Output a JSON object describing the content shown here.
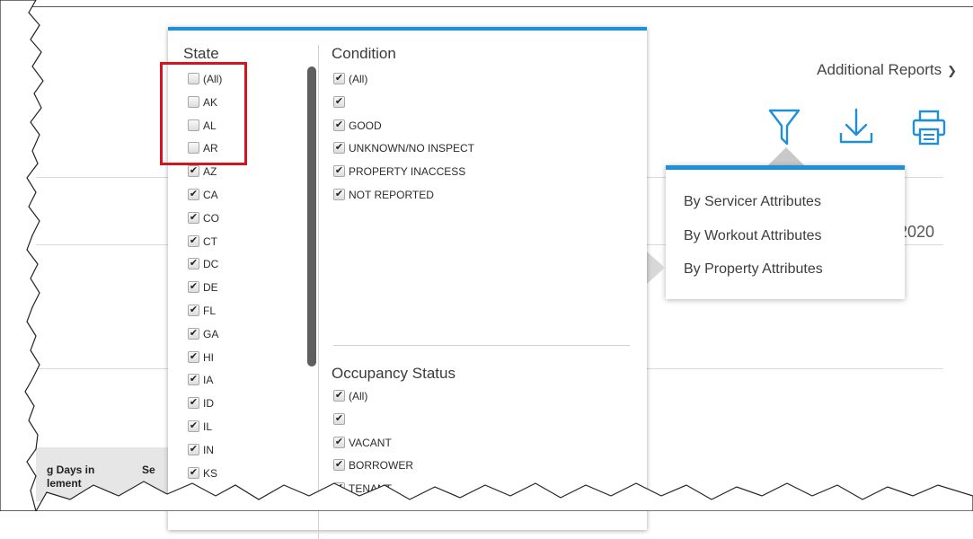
{
  "header": {
    "additional_reports_label": "Additional Reports"
  },
  "toolbar": {
    "icons": [
      "filter-icon",
      "download-icon",
      "print-icon"
    ],
    "accent_color": "#1e8fd9"
  },
  "background": {
    "year_partial": "2020",
    "grid_headers": [
      "g Days in lement",
      "Se"
    ]
  },
  "filter_panel": {
    "state": {
      "title": "State",
      "items": [
        {
          "label": "(All)",
          "checked": false
        },
        {
          "label": "AK",
          "checked": false
        },
        {
          "label": "AL",
          "checked": false
        },
        {
          "label": "AR",
          "checked": false
        },
        {
          "label": "AZ",
          "checked": true
        },
        {
          "label": "CA",
          "checked": true
        },
        {
          "label": "CO",
          "checked": true
        },
        {
          "label": "CT",
          "checked": true
        },
        {
          "label": "DC",
          "checked": true
        },
        {
          "label": "DE",
          "checked": true
        },
        {
          "label": "FL",
          "checked": true
        },
        {
          "label": "GA",
          "checked": true
        },
        {
          "label": "HI",
          "checked": true
        },
        {
          "label": "IA",
          "checked": true
        },
        {
          "label": "ID",
          "checked": true
        },
        {
          "label": "IL",
          "checked": true
        },
        {
          "label": "IN",
          "checked": true
        },
        {
          "label": "KS",
          "checked": true
        }
      ]
    },
    "condition": {
      "title": "Condition",
      "items": [
        {
          "label": "(All)",
          "checked": true
        },
        {
          "label": "",
          "checked": true
        },
        {
          "label": "GOOD",
          "checked": true
        },
        {
          "label": "UNKNOWN/NO INSPECT",
          "checked": true
        },
        {
          "label": "PROPERTY INACCESS",
          "checked": true
        },
        {
          "label": "NOT REPORTED",
          "checked": true
        }
      ]
    },
    "occupancy": {
      "title": "Occupancy Status",
      "items": [
        {
          "label": "(All)",
          "checked": true
        },
        {
          "label": "",
          "checked": true
        },
        {
          "label": "VACANT",
          "checked": true
        },
        {
          "label": "BORROWER",
          "checked": true
        },
        {
          "label": "TENANT",
          "checked": true
        }
      ]
    },
    "highlight_color": "#d3151d"
  },
  "reports_menu": {
    "items": [
      "By Servicer Attributes",
      "By Workout Attributes",
      "By Property Attributes"
    ]
  }
}
